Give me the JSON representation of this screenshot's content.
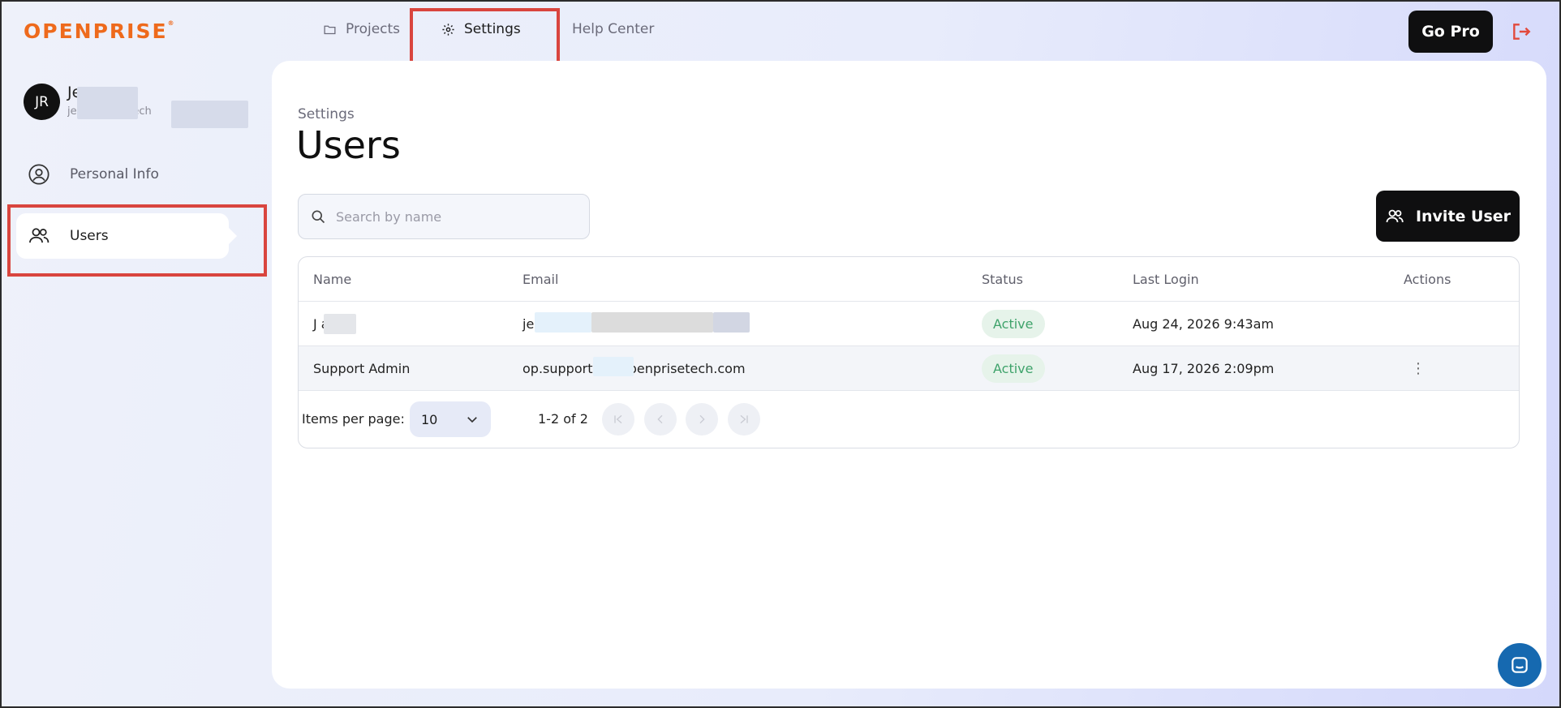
{
  "brand": {
    "logo_text": "OPENPRISE",
    "logo_mark": "®",
    "accent": "#ee6a1c"
  },
  "topnav": {
    "items": [
      {
        "label": "Projects",
        "icon": "folder-icon"
      },
      {
        "label": "Settings",
        "icon": "gear-icon",
        "active": true
      },
      {
        "label": "Help Center"
      }
    ],
    "go_pro_label": "Go Pro",
    "logout_icon": "logout-icon"
  },
  "sidebar": {
    "user": {
      "initials": "JR",
      "name_visible": "Je          a",
      "email_visible": "je           a+testi                etech"
    },
    "items": [
      {
        "label": "Personal Info",
        "icon": "user-circle-icon"
      },
      {
        "label": "Users",
        "icon": "users-icon",
        "active": true
      }
    ]
  },
  "main": {
    "breadcrumb": "Settings",
    "title": "Users",
    "search": {
      "placeholder": "Search by name",
      "value": ""
    },
    "invite_label": "Invite User",
    "table": {
      "columns": [
        "Name",
        "Email",
        "Status",
        "Last Login",
        "Actions"
      ],
      "rows": [
        {
          "name": "J          a",
          "email": "je                                                ch.com",
          "status": "Active",
          "last_login": "Aug 24, 2026 9:43am",
          "has_actions": false
        },
        {
          "name": "Support Admin",
          "email": "op.support+           @openprisetech.com",
          "status": "Active",
          "last_login": "Aug 17, 2026 2:09pm",
          "has_actions": true
        }
      ]
    },
    "pagination": {
      "items_per_page_label": "Items per page:",
      "items_per_page_value": "10",
      "range_text": "1-2 of 2"
    }
  },
  "colors": {
    "highlight": "#d9453e",
    "active_badge_bg": "#e6f3ea",
    "active_badge_text": "#3fa36b",
    "primary_button": "#0f0f10",
    "chat_button": "#1669b0"
  }
}
